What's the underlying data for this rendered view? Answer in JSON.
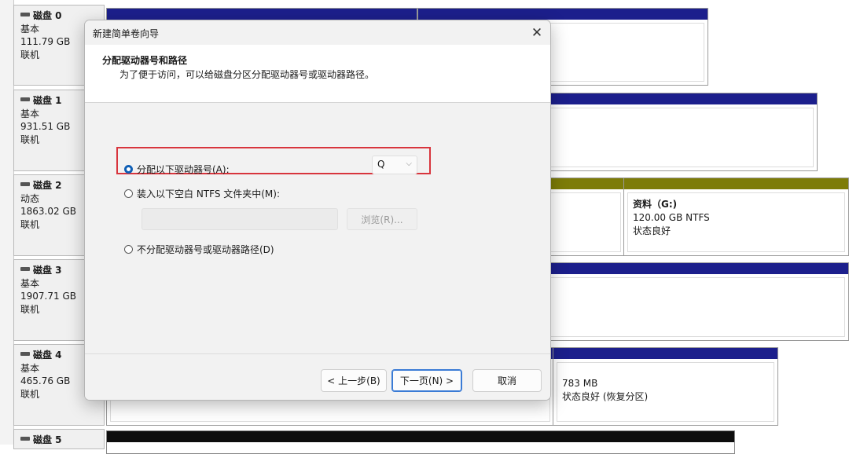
{
  "disks": [
    {
      "name": "磁盘 0",
      "type": "基本",
      "size": "111.79 GB",
      "status": "联机"
    },
    {
      "name": "磁盘 1",
      "type": "基本",
      "size": "931.51 GB",
      "status": "联机"
    },
    {
      "name": "磁盘 2",
      "type": "动态",
      "size": "1863.02 GB",
      "status": "联机"
    },
    {
      "name": "磁盘 3",
      "type": "基本",
      "size": "1907.71 GB",
      "status": "联机"
    },
    {
      "name": "磁盘 4",
      "type": "基本",
      "size": "465.76 GB",
      "status": "联机"
    },
    {
      "name": "磁盘 5"
    }
  ],
  "partitions": {
    "g_volume": {
      "title": "资料（G:)",
      "size": "120.00 GB NTFS",
      "status": "状态良好"
    },
    "recovery": {
      "size": "783 MB",
      "status": "状态良好 (恢复分区)"
    }
  },
  "colors": {
    "basic_bar": "#1c1f8c",
    "dynamic_bar": "#7d7c08",
    "unallocated_bar": "#0d0d0d",
    "highlight": "#d8353d",
    "accent": "#0f5fb5"
  },
  "dialog": {
    "title": "新建简单卷向导",
    "close_icon": "close-icon",
    "header_title": "分配驱动器号和路径",
    "header_subtitle": "为了便于访问，可以给磁盘分区分配驱动器号或驱动器路径。",
    "options": {
      "assign_letter": "分配以下驱动器号(A):",
      "mount_folder": "装入以下空白 NTFS 文件夹中(M):",
      "no_assign": "不分配驱动器号或驱动器路径(D)"
    },
    "selected_option": "assign_letter",
    "drive_letter": "Q",
    "folder_path": "",
    "browse_label": "浏览(R)...",
    "buttons": {
      "back": "< 上一步(B)",
      "next": "下一页(N) >",
      "cancel": "取消"
    }
  }
}
